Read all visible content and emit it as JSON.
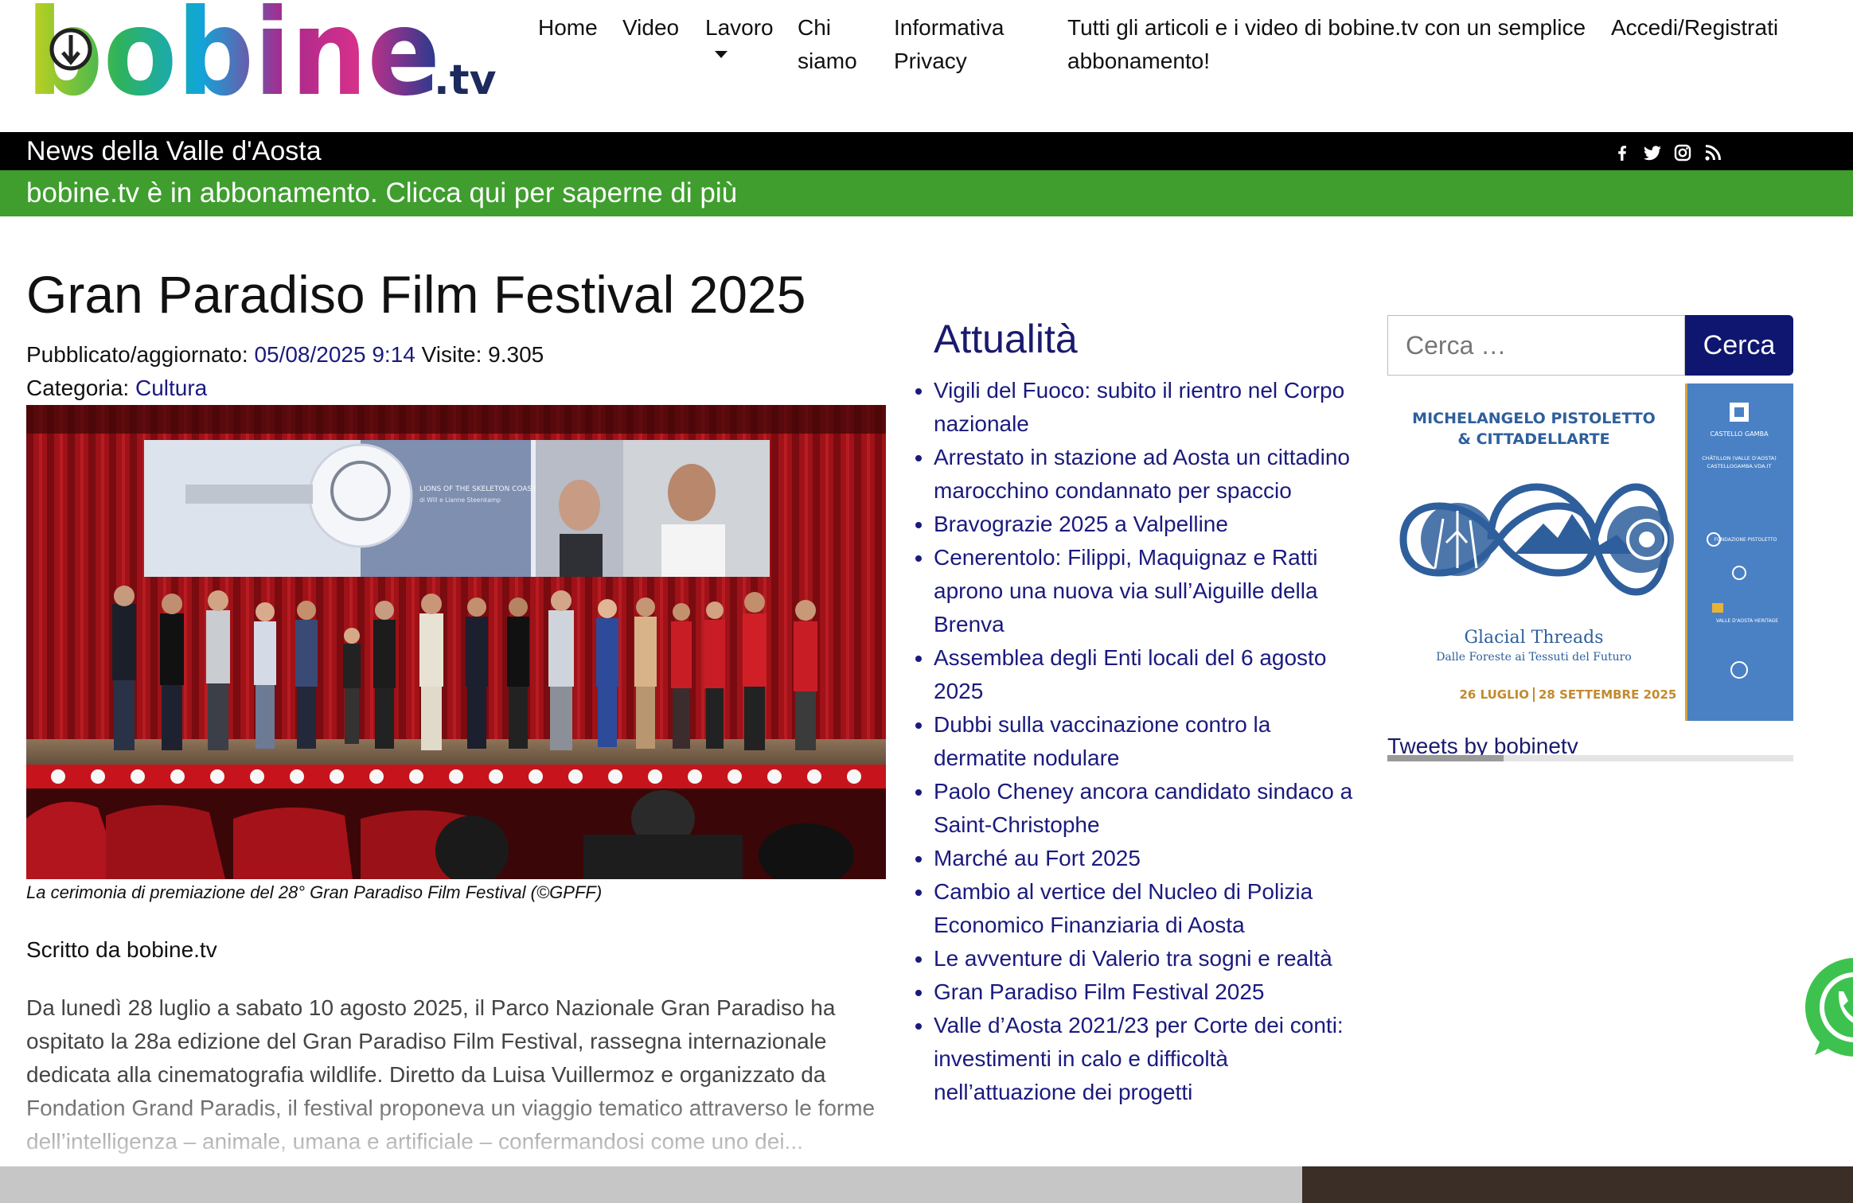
{
  "header": {
    "logo": {
      "main": "bobine",
      "suffix": ".tv"
    },
    "nav": [
      {
        "label": "Home"
      },
      {
        "label": "Video"
      },
      {
        "label": "Lavoro"
      },
      {
        "label": "Chi siamo"
      },
      {
        "label": "Informativa Privacy"
      },
      {
        "label": "Tutti gli articoli e i video di bobine.tv con un semplice abbonamento!"
      },
      {
        "label": "Accedi/Registrati"
      }
    ]
  },
  "newsbar": {
    "title": "News della Valle d'Aosta",
    "social_icons": [
      "facebook-icon",
      "twitter-icon",
      "instagram-icon",
      "rss-icon"
    ]
  },
  "subscription_banner": "bobine.tv è in abbonamento. Clicca qui per saperne di più",
  "article": {
    "title": "Gran Paradiso Film Festival 2025",
    "published_label": "Pubblicato/aggiornato:",
    "published_date": "05/08/2025 9:14",
    "visits_label": "Visite:",
    "visits": "9.305",
    "category_label": "Categoria:",
    "category": "Cultura",
    "screen_caption_line1": "LIONS OF THE SKELETON COAST",
    "screen_caption_line2": "di Will e Lianne Steenkamp",
    "caption": "La cerimonia di premiazione del 28° Gran Paradiso Film Festival (©GPFF)",
    "author": "Scritto da bobine.tv",
    "excerpt": "Da lunedì 28 luglio a sabato 10 agosto 2025, il Parco Nazionale Gran Paradiso ha ospitato la 28a edizione del Gran Paradiso Film Festival, rassegna internazionale dedicata alla cinematografia wildlife. Diretto da Luisa Vuillermoz e organizzato da Fondation Grand Paradis, il festival proponeva un viaggio tematico attraverso le forme dell’intelligenza – animale, umana e artificiale – confermandosi come uno dei..."
  },
  "attualita": {
    "title": "Attualità",
    "items": [
      "Vigili del Fuoco: subito il rientro nel Corpo nazionale",
      "Arrestato in stazione ad Aosta un cittadino marocchino condannato per spaccio",
      "Bravograzie 2025 a Valpelline",
      "Cenerentolo: Filippi, Maquignaz e Ratti aprono una nuova via sull’Aiguille della Brenva",
      "Assemblea degli Enti locali del 6 agosto 2025",
      "Dubbi sulla vaccinazione contro la dermatite nodulare",
      "Paolo Cheney ancora candidato sindaco a Saint-Christophe",
      "Marché au Fort 2025",
      "Cambio al vertice del Nucleo di Polizia Economico Finanziaria di Aosta",
      "Le avventure di Valerio tra sogni e realtà",
      "Gran Paradiso Film Festival 2025",
      "Valle d’Aosta 2021/23 per Corte dei conti: investimenti in calo e difficoltà nell’attuazione dei progetti"
    ]
  },
  "sidebar": {
    "search_placeholder": "Cerca …",
    "search_button": "Cerca",
    "ad": {
      "headline_line1": "MICHELANGELO PISTOLETTO",
      "headline_line2": "& CITTADELLARTE",
      "title": "Glacial Threads",
      "subtitle": "Dalle Foreste ai Tessuti del Futuro",
      "date_start": "26 LUGLIO",
      "date_end": "28 SETTEMBRE 2025",
      "side_castello": "CASTELLO GAMBA",
      "side_place": "CHÂTILLON (VALLE D'AOSTA)",
      "side_site": "CASTELLOGAMBA.VDA.IT",
      "side_fondazione": "FONDAZIONE PISTOLETTO",
      "side_regione": "VALLE D'AOSTA HERITAGE"
    },
    "tweets_link": "Tweets by bobinetv"
  },
  "colors": {
    "link": "#1a1a7e",
    "heading": "#1a1a6e",
    "green_banner": "#3f9e2e",
    "news_bar": "#000000",
    "search_button": "#0e1670"
  }
}
